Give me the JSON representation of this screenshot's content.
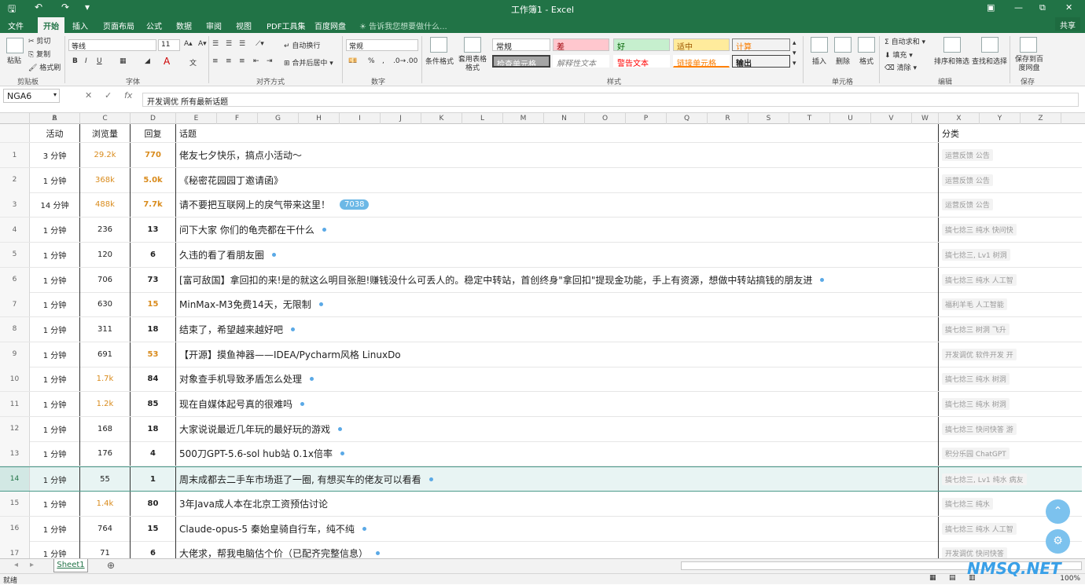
{
  "title": "工作簿1 - Excel",
  "titlebar": {
    "quick_access": [
      "save-icon",
      "undo-icon",
      "redo-icon",
      "customize-icon"
    ]
  },
  "tabs": [
    "文件",
    "开始",
    "插入",
    "页面布局",
    "公式",
    "数据",
    "审阅",
    "视图",
    "PDF工具集",
    "百度网盘"
  ],
  "active_tab": "开始",
  "tell_me": "告诉我您想要做什么...",
  "share": "共享",
  "ribbon": {
    "clipboard": {
      "paste": "粘贴",
      "cut": "剪切",
      "copy": "复制",
      "format_painter": "格式刷",
      "label": "剪贴板"
    },
    "font": {
      "name": "等线",
      "size": "11",
      "label": "字体"
    },
    "alignment": {
      "wrap": "自动换行",
      "merge": "合并后居中",
      "label": "对齐方式"
    },
    "number": {
      "format": "常规",
      "label": "数字"
    },
    "styles": {
      "cond_format": "条件格式",
      "table_format": "套用表格格式",
      "label": "样式",
      "items": [
        "常规",
        "差",
        "好",
        "适中",
        "计算",
        "检查单元格",
        "解释性文本",
        "警告文本",
        "链接单元格",
        "输出"
      ]
    },
    "cells": {
      "insert": "插入",
      "delete": "删除",
      "format": "格式",
      "label": "单元格"
    },
    "editing": {
      "autosum": "自动求和",
      "fill": "填充",
      "clear": "清除",
      "sort": "排序和筛选",
      "find": "查找和选择",
      "label": "编辑"
    },
    "save": {
      "save_to": "保存到百度网盘",
      "label": "保存"
    }
  },
  "name_box": "NGA6",
  "formula": "开发调优 所有最新话题",
  "columns": [
    "A",
    "B",
    "C",
    "D",
    "E",
    "F",
    "G",
    "H",
    "I",
    "J",
    "K",
    "L",
    "M",
    "N",
    "O",
    "P",
    "Q",
    "R",
    "S",
    "T",
    "U",
    "V",
    "W",
    "X",
    "Y",
    "Z"
  ],
  "headers": {
    "activity": "活动",
    "views": "浏览量",
    "replies": "回复",
    "topic": "话题",
    "category": "分类"
  },
  "rows": [
    {
      "n": "1",
      "act": "3 分钟",
      "views": "29.2k",
      "rep": "770",
      "topic": "佬友七夕快乐，搞点小活动～",
      "cat": "运营反馈  公告",
      "hot": true
    },
    {
      "n": "2",
      "act": "1 分钟",
      "views": "368k",
      "rep": "5.0k",
      "topic": "《秘密花园园丁邀请函》",
      "cat": "运营反馈  公告",
      "hot": true
    },
    {
      "n": "3",
      "act": "14 分钟",
      "views": "488k",
      "rep": "7.7k",
      "topic": "请不要把互联网上的戾气带来这里！",
      "badge": "7038",
      "cat": "运营反馈  公告",
      "hot": true
    },
    {
      "n": "4",
      "act": "1 分钟",
      "views": "236",
      "rep": "13",
      "topic": "问下大家 你们的龟壳都在干什么",
      "dot": true,
      "cat": "搞七捻三  纯水  快问快"
    },
    {
      "n": "5",
      "act": "1 分钟",
      "views": "120",
      "rep": "6",
      "topic": "久违的看了看朋友圈",
      "dot": true,
      "cat": "搞七捻三, Lv1  树洞"
    },
    {
      "n": "6",
      "act": "1 分钟",
      "views": "706",
      "rep": "73",
      "topic": "[富可敌国】拿回扣的来!是的就这么明目张胆!赚钱没什么可丢人的。稳定中转站，首创终身\"拿回扣\"提现金功能，手上有资源，想做中转站搞钱的朋友进",
      "dot": true,
      "cat": "搞七捻三  纯水  人工智"
    },
    {
      "n": "7",
      "act": "1 分钟",
      "views": "630",
      "rep": "15",
      "repHot": true,
      "topic": "MinMax-M3免费14天，无限制",
      "dot": true,
      "cat": "福利羊毛  人工智能"
    },
    {
      "n": "8",
      "act": "1 分钟",
      "views": "311",
      "rep": "18",
      "topic": "结束了，希望越来越好吧",
      "dot": true,
      "cat": "搞七捻三  树洞  飞升"
    },
    {
      "n": "9",
      "act": "1 分钟",
      "views": "691",
      "rep": "53",
      "repHot": true,
      "topic": "【开源】摸鱼神器——IDEA/Pycharm风格 LinuxDo",
      "cat": "开发调优  软件开发  开"
    },
    {
      "n": "10",
      "act": "1 分钟",
      "views": "1.7k",
      "viewsHot": true,
      "rep": "84",
      "topic": "对象查手机导致矛盾怎么处理",
      "dot": true,
      "cat": "搞七捻三  纯水  树洞"
    },
    {
      "n": "11",
      "act": "1 分钟",
      "views": "1.2k",
      "viewsHot": true,
      "rep": "85",
      "topic": "现在自媒体起号真的很难吗",
      "dot": true,
      "cat": "搞七捻三  纯水  树洞"
    },
    {
      "n": "12",
      "act": "1 分钟",
      "views": "168",
      "rep": "18",
      "topic": "大家说说最近几年玩的最好玩的游戏",
      "dot": true,
      "cat": "搞七捻三  快问快答  游"
    },
    {
      "n": "13",
      "act": "1 分钟",
      "views": "176",
      "rep": "4",
      "topic": "500刀GPT-5.6-sol hub站 0.1x倍率",
      "dot": true,
      "cat": "积分乐园  ChatGPT"
    },
    {
      "n": "14",
      "act": "1 分钟",
      "views": "55",
      "rep": "1",
      "topic": "周末成都去二手车市场逛了一圈, 有想买车的佬友可以看看",
      "dot": true,
      "cat": "搞七捻三, Lv1  纯水  病友",
      "selected": true
    },
    {
      "n": "15",
      "act": "1 分钟",
      "views": "1.4k",
      "viewsHot": true,
      "rep": "80",
      "topic": "3年Java成人本在北京工资预估讨论",
      "cat": "搞七捻三  纯水"
    },
    {
      "n": "16",
      "act": "1 分钟",
      "views": "764",
      "rep": "15",
      "topic": "Claude-opus-5 秦始皇骑自行车，纯不纯",
      "dot": true,
      "cat": "搞七捻三  纯水  人工智"
    },
    {
      "n": "17",
      "act": "1 分钟",
      "views": "71",
      "rep": "6",
      "topic": "大佬求，帮我电脑估个价（已配齐完整信息）",
      "dot": true,
      "cat": "开发调优  快问快答"
    }
  ],
  "sheet_tab": "Sheet1",
  "status": "就绪",
  "zoom": "100%",
  "watermark": "NMSQ.NET",
  "colors": {
    "excel_green": "#217346",
    "hot": "#d98b1c",
    "dot": "#5aa9e6"
  }
}
